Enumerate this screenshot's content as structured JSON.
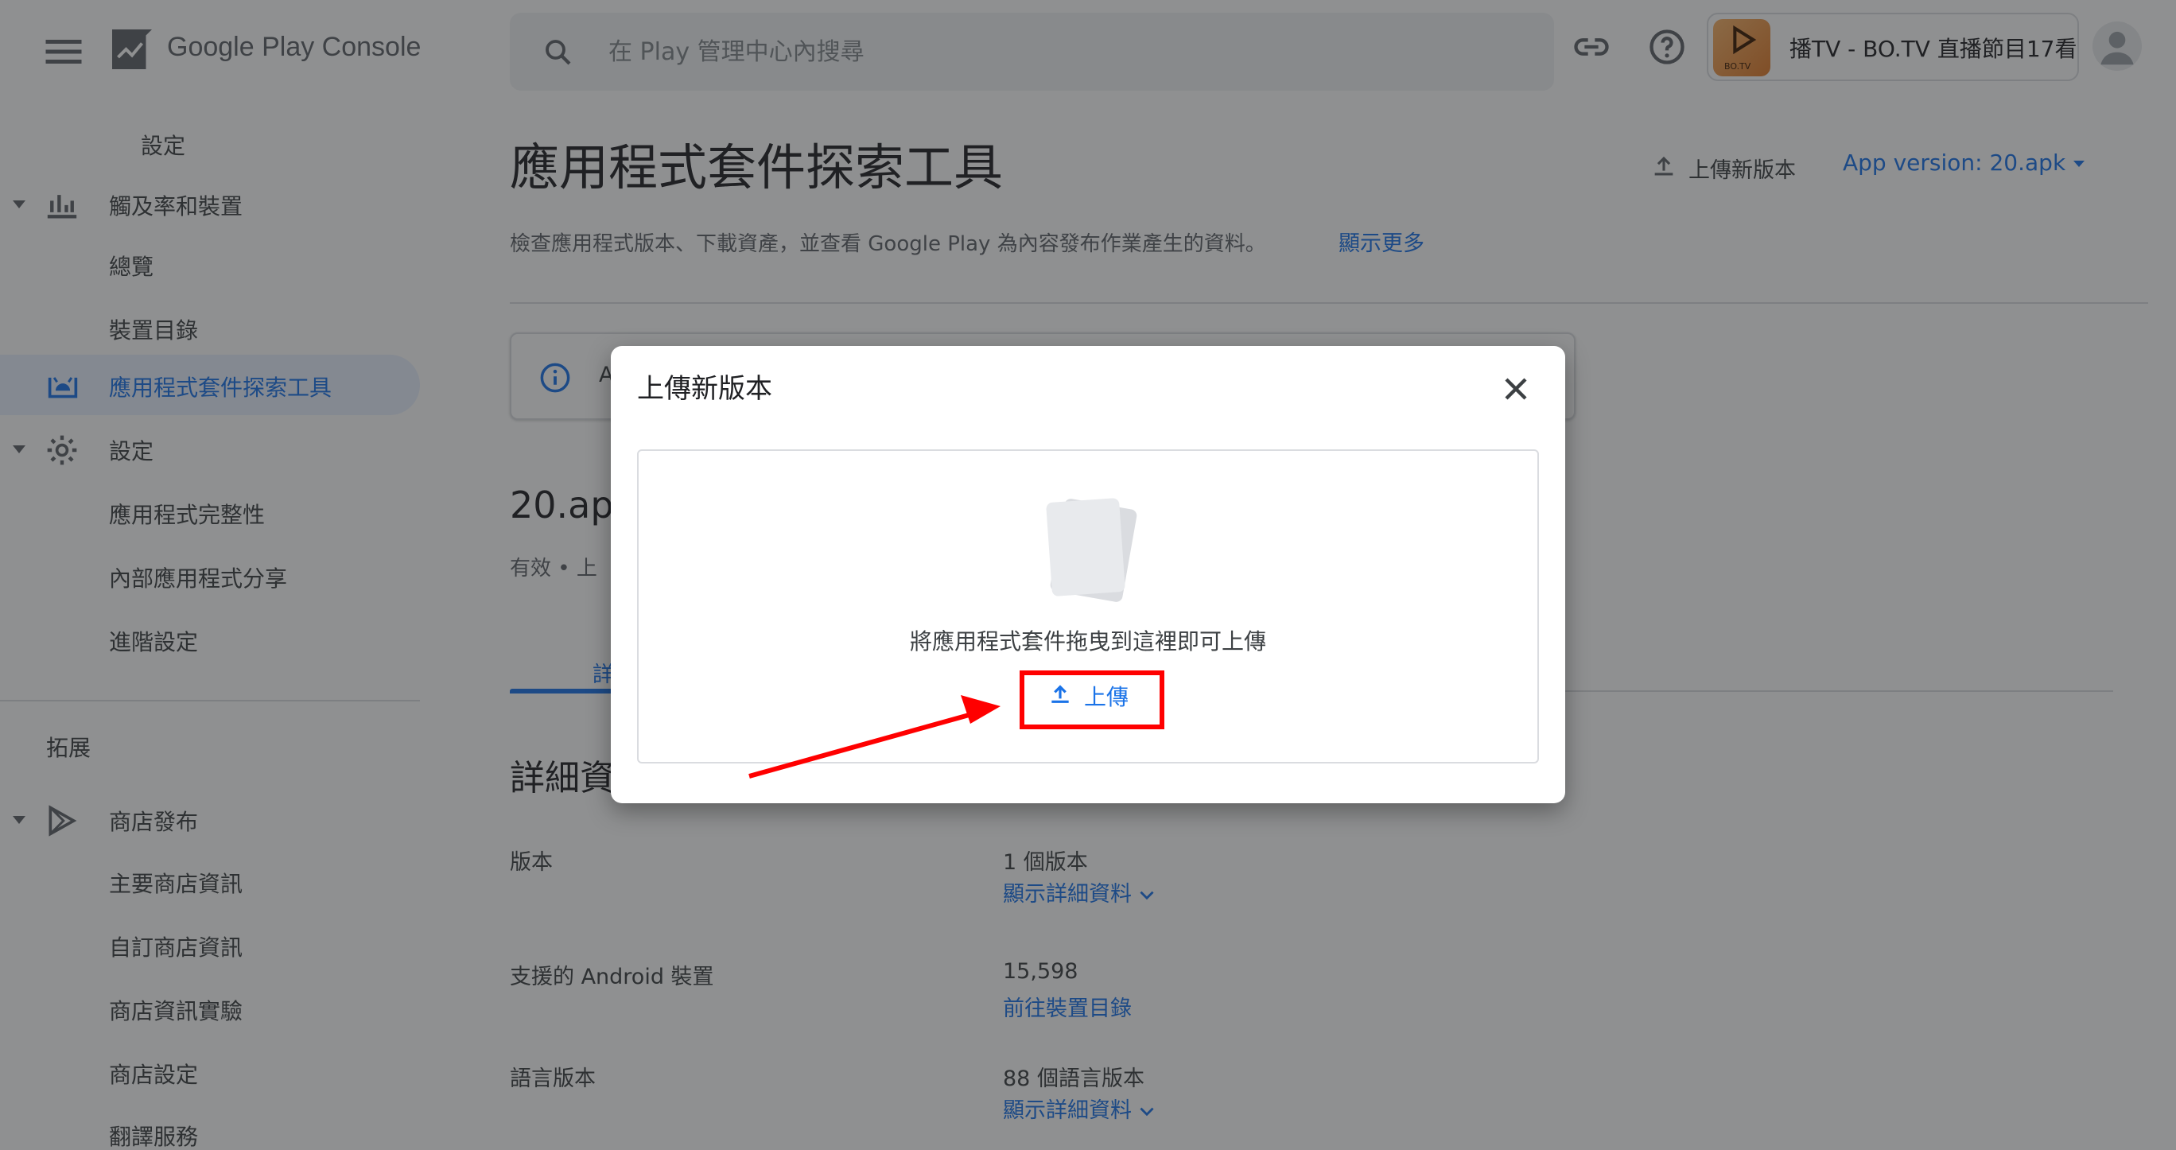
{
  "topbar": {
    "logo_text": "Google Play Console",
    "search_placeholder": "在 Play 管理中心內搜尋",
    "account_name": "播TV - BO.TV 直播節目17看",
    "account_icon_tag": "BO.TV"
  },
  "sidebar": {
    "items": [
      {
        "label": "設定"
      },
      {
        "label": "觸及率和裝置"
      },
      {
        "label": "總覽"
      },
      {
        "label": "裝置目錄"
      },
      {
        "label": "應用程式套件探索工具"
      },
      {
        "label": "設定"
      },
      {
        "label": "應用程式完整性"
      },
      {
        "label": "內部應用程式分享"
      },
      {
        "label": "進階設定"
      }
    ],
    "section_title": "拓展",
    "store_items": [
      {
        "label": "商店發布"
      },
      {
        "label": "主要商店資訊"
      },
      {
        "label": "自訂商店資訊"
      },
      {
        "label": "商店資訊實驗"
      },
      {
        "label": "商店設定"
      },
      {
        "label": "翻譯服務"
      }
    ]
  },
  "main": {
    "page_title": "應用程式套件探索工具",
    "upload_new_version": "上傳新版本",
    "version_select": "App version: 20.apk",
    "subtitle": "檢查應用程式版本、下載資產，並查看 Google Play 為內容發布作業產生的資料。",
    "show_more": "顯示更多",
    "banner_text": "A",
    "apk_title": "20.ap",
    "apk_status": "有效 • 上",
    "tab_details": "詳",
    "section_heading": "詳細資",
    "rows": [
      {
        "label": "版本",
        "value": "1 個版本",
        "link": "顯示詳細資料"
      },
      {
        "label": "支援的 Android 裝置",
        "value": "15,598",
        "link": "前往裝置目錄"
      },
      {
        "label": "語言版本",
        "value": "88 個語言版本",
        "link": "顯示詳細資料"
      }
    ]
  },
  "dialog": {
    "title": "上傳新版本",
    "drop_hint": "將應用程式套件拖曳到這裡即可上傳",
    "upload_label": "上傳"
  },
  "colors": {
    "accent": "#1a73e8",
    "annotation": "#ff0000",
    "scrim": "rgba(32,33,36,0.5)"
  }
}
